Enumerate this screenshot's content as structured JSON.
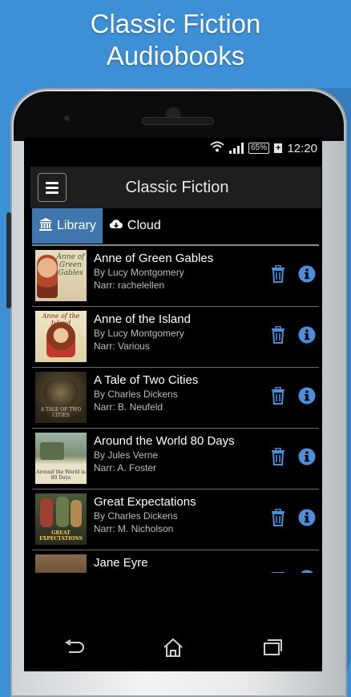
{
  "promo": {
    "line1": "Classic Fiction",
    "line2": "Audiobooks"
  },
  "status_bar": {
    "battery": "65%",
    "charging": "+",
    "time": "12:20"
  },
  "app_bar": {
    "title": "Classic Fiction"
  },
  "tabs": [
    {
      "label": "Library",
      "icon": "library-icon",
      "active": true
    },
    {
      "label": "Cloud",
      "icon": "cloud-download-icon",
      "active": false
    }
  ],
  "books": [
    {
      "title": "Anne of Green Gables",
      "author": "By Lucy Montgomery",
      "narrator": "Narr: rachelellen",
      "cover_text": "Anne of Green Gables"
    },
    {
      "title": "Anne of the Island",
      "author": "By Lucy Montgomery",
      "narrator": "Narr: Various",
      "cover_text": "Anne of the Island"
    },
    {
      "title": "A Tale of Two Cities",
      "author": "By Charles Dickens",
      "narrator": "Narr: B. Neufeld",
      "cover_text": "A TALE OF TWO CITIES"
    },
    {
      "title": "Around the World 80 Days",
      "author": "By Jules Verne",
      "narrator": "Narr: A. Foster",
      "cover_text": "Around the World in 80 Days"
    },
    {
      "title": "Great Expectations",
      "author": "By Charles Dickens",
      "narrator": "Narr: M. Nicholson",
      "cover_text": "GREAT EXPECTATIONS"
    },
    {
      "title": "Jane Eyre",
      "author": "",
      "narrator": "",
      "cover_text": ""
    }
  ],
  "colors": {
    "accent": "#3f76ad",
    "icon_blue": "#4a8fdc",
    "promo_bg": "#3d8fd6"
  }
}
